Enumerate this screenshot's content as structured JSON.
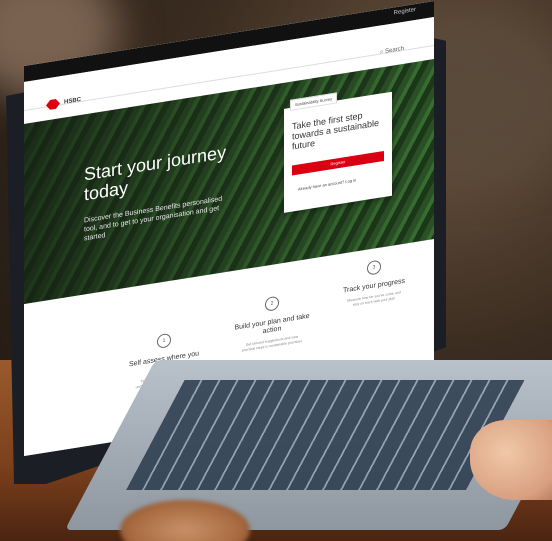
{
  "screen": {
    "topbar": "Register",
    "brand": "HSBC",
    "search_label": "Search",
    "hero": {
      "title": "Start your journey today",
      "subtitle": "Discover the Business Benefits personalised tool, and to get to your organisation and get started"
    },
    "card": {
      "tab": "Sustainability Survey",
      "title": "Take the first step towards a sustainable future",
      "button": "Register",
      "link": "Already have an account? Log in"
    },
    "steps": [
      {
        "num": "1",
        "title": "Self assess where you stand",
        "desc": "Take our free assessment and understand your sustainability profile"
      },
      {
        "num": "2",
        "title": "Build your plan and take action",
        "desc": "Get tailored suggestions and view practical steps to sustainable practices"
      },
      {
        "num": "3",
        "title": "Track your progress",
        "desc": "Measure how far you've come and stay on track with your plan"
      }
    ]
  },
  "colors": {
    "brand_red": "#db0011",
    "hero_green": "#2f5a2a"
  }
}
